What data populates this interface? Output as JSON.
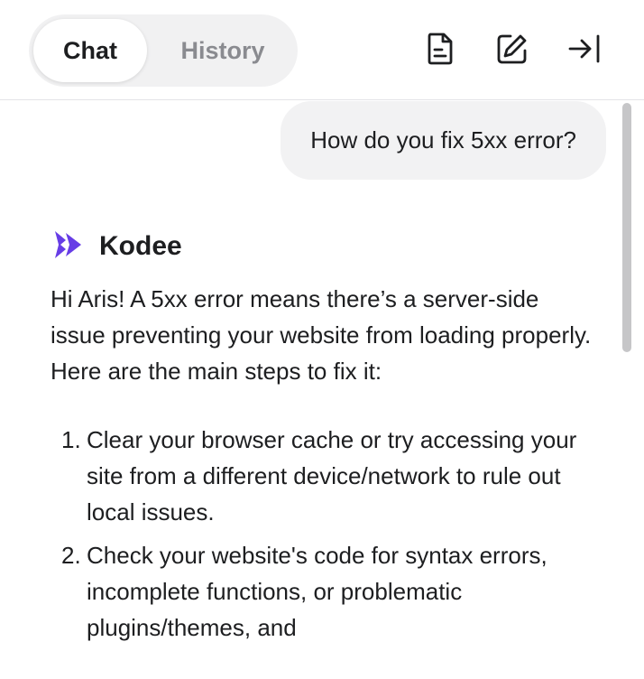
{
  "header": {
    "tabs": [
      {
        "label": "Chat",
        "active": true
      },
      {
        "label": "History",
        "active": false
      }
    ],
    "icons": [
      "document-icon",
      "edit-icon",
      "collapse-panel-icon"
    ]
  },
  "chat": {
    "user_message": "How do you fix 5xx error?",
    "assistant": {
      "name": "Kodee",
      "logo_color": "#673de6",
      "intro": "Hi Aris! A 5xx error means there’s a server-side issue preventing your website from loading properly. Here are the main steps to fix it:",
      "steps": [
        {
          "number": "1.",
          "text": "Clear your browser cache or try accessing your site from a different device/network to rule out local issues."
        },
        {
          "number": "2.",
          "text": "Check your website's code for syntax errors, incomplete functions, or problematic plugins/themes, and"
        }
      ]
    }
  }
}
